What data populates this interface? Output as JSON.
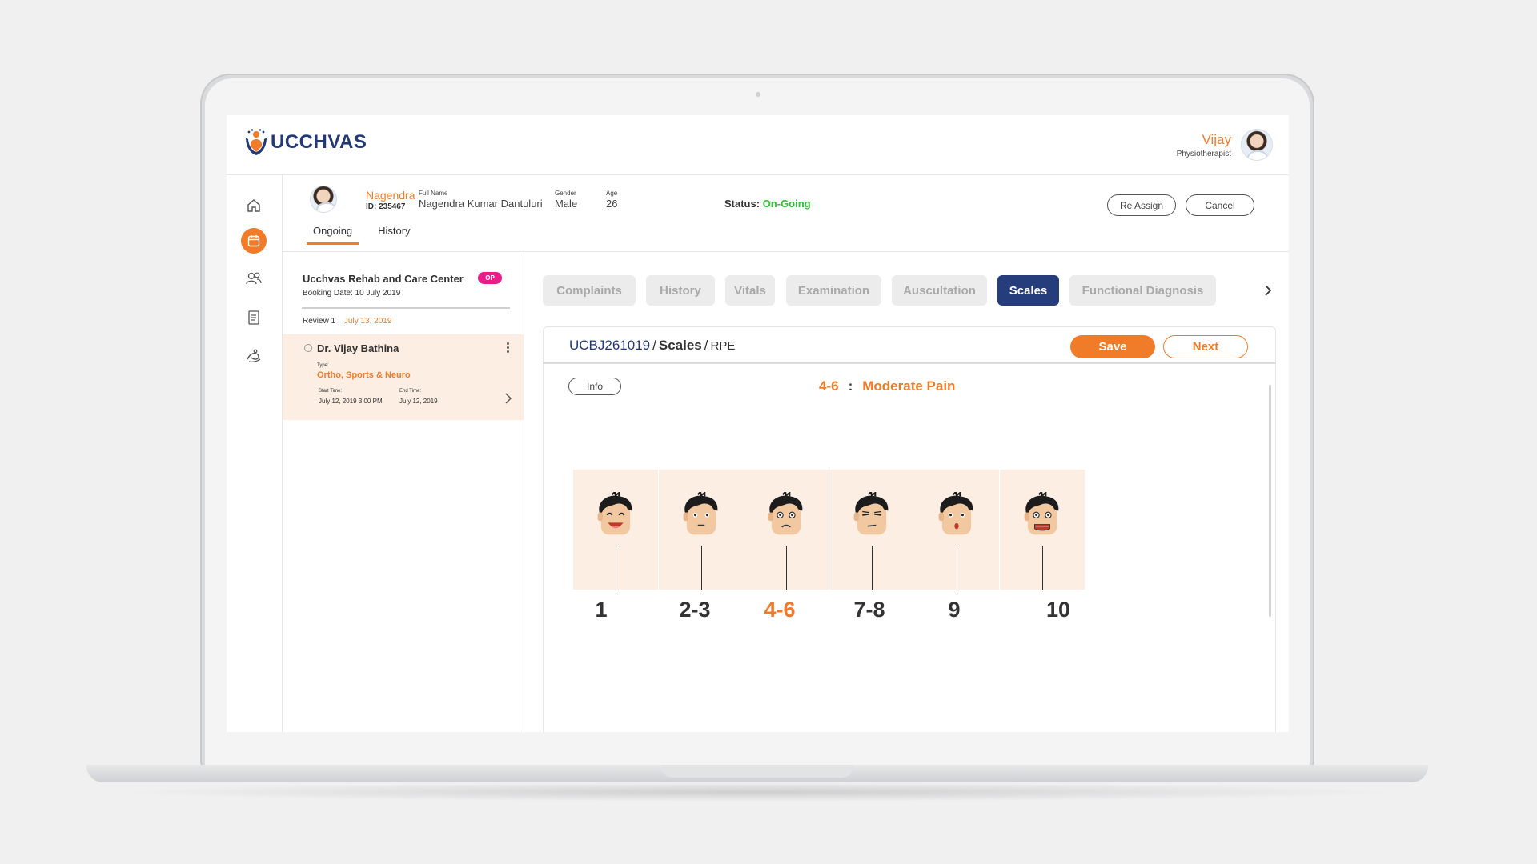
{
  "app": {
    "brand": "UCCHVAS",
    "user": {
      "name": "Vijay",
      "role": "Physiotherapist"
    }
  },
  "nav": [
    "home-icon",
    "calendar-icon",
    "users-icon",
    "report-icon",
    "exercise-icon"
  ],
  "patient": {
    "name": "Nagendra",
    "id_text": "ID: 235467",
    "full_name_label": "Full Name",
    "full_name": "Nagendra Kumar Dantuluri",
    "gender_label": "Gender",
    "gender": "Male",
    "age_label": "Age",
    "age": "26",
    "status_label": "Status:",
    "status_value": "On-Going",
    "reassign_label": "Re Assign",
    "cancel_label": "Cancel",
    "tabs": [
      "Ongoing",
      "History"
    ]
  },
  "visit": {
    "center": "Ucchvas Rehab and Care Center",
    "badge": "OP",
    "booking": "Booking Date:  10 July 2019",
    "review_label": "Review 1",
    "review_date": "July 13, 2019",
    "doctor": "Dr. Vijay Bathina",
    "type_label": "Type:",
    "type_value": "Ortho, Sports & Neuro",
    "start_label": "Start Time:",
    "start_value": "July 12, 2019  3:00 PM",
    "end_label": "End Time:",
    "end_value": "July 12, 2019"
  },
  "section_tabs": [
    "Complaints",
    "History",
    "Vitals",
    "Examination",
    "Auscultation",
    "Scales",
    "Functional Diagnosis"
  ],
  "active_section": "Scales",
  "card": {
    "code": "UCBJ261019",
    "crumb_mid": "Scales",
    "crumb_last": "RPE",
    "save_label": "Save",
    "next_label": "Next",
    "info_label": "Info",
    "selected_range": "4-6",
    "selected_text": "Moderate Pain"
  },
  "scale": {
    "levels": [
      "1",
      "2-3",
      "4-6",
      "7-8",
      "9",
      "10"
    ],
    "selected_index": 2,
    "accent": "#f07c2a",
    "cell_bg": "#fdeee4"
  }
}
